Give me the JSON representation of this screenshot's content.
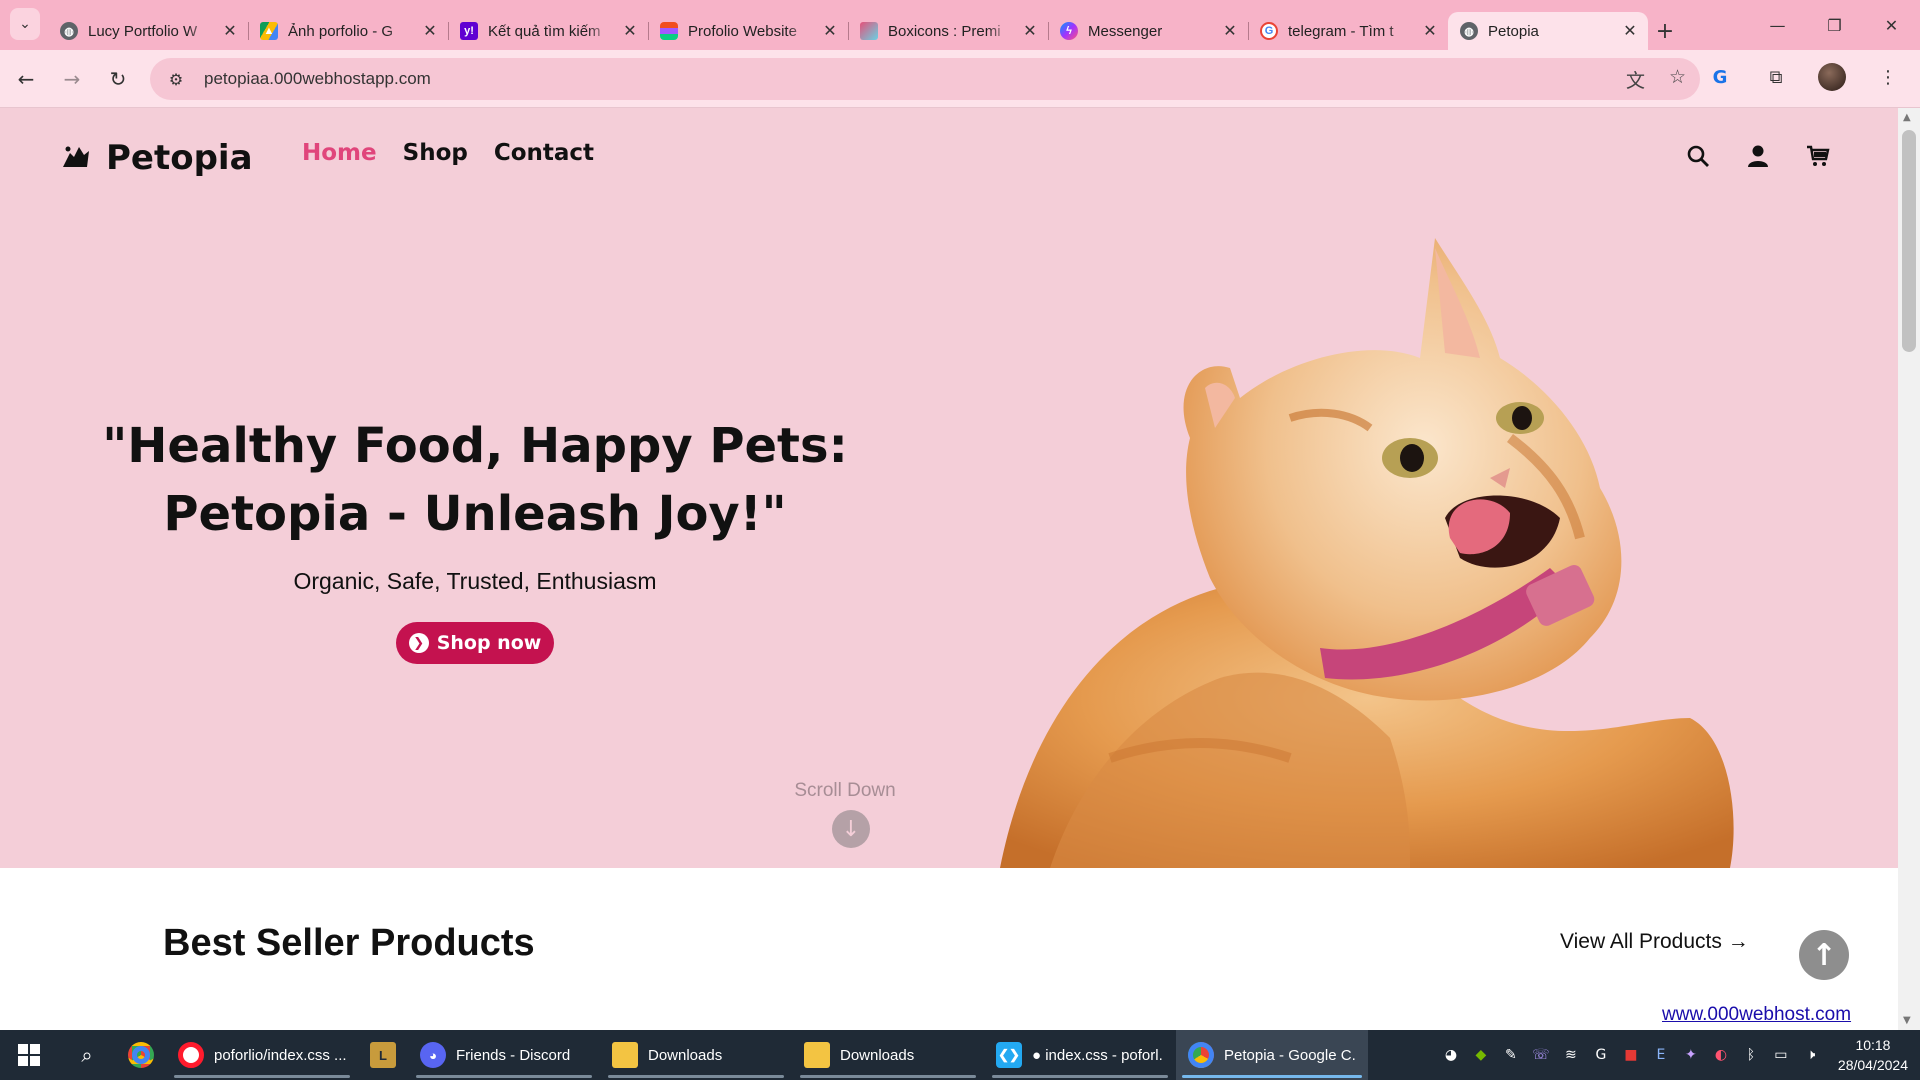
{
  "browser": {
    "tabs": [
      {
        "title": "Lucy Portfolio W",
        "icon": "globe-icon",
        "color": "#5f6368"
      },
      {
        "title": "Ảnh porfolio - G",
        "icon": "google-drive-icon",
        "color": "#1fa463"
      },
      {
        "title": "Kết quả tìm kiếm",
        "icon": "yahoo-icon",
        "color": "#6001d2"
      },
      {
        "title": "Profolio Website",
        "icon": "figma-icon",
        "color": "#f24e1e"
      },
      {
        "title": "Boxicons : Premi",
        "icon": "boxicons-icon",
        "color": "#e4527a"
      },
      {
        "title": "Messenger",
        "icon": "messenger-icon",
        "color": "#7c4dff"
      },
      {
        "title": "telegram - Tìm t",
        "icon": "google-icon",
        "color": "#4285f4"
      },
      {
        "title": "Petopia",
        "icon": "globe-icon",
        "color": "#5f6368",
        "active": true
      }
    ],
    "url": "petopiaa.000webhostapp.com"
  },
  "site": {
    "logo": "Petopia",
    "nav": [
      {
        "label": "Home",
        "active": true
      },
      {
        "label": "Shop"
      },
      {
        "label": "Contact"
      }
    ],
    "hero": {
      "headline_line1": "\"Healthy Food, Happy Pets:",
      "headline_line2": "Petopia - Unleash Joy!\"",
      "subline": "Organic, Safe, Trusted, Enthusiasm",
      "cta": "Shop now",
      "scroll_label": "Scroll Down"
    },
    "best_seller": {
      "title": "Best Seller Products",
      "view_all": "View All Products"
    },
    "host_link": "www.000webhost.com",
    "colors": {
      "accent": "#e0457b",
      "button": "#c4124f",
      "hero_bg": "#f4ced8"
    }
  },
  "taskbar": {
    "items": [
      {
        "label": "",
        "icon": "chrome-icon",
        "color": "#4285f4"
      },
      {
        "label": "poforlio/index.css ...",
        "icon": "opera-icon",
        "color": "#ff1b2d",
        "wide": true
      },
      {
        "label": "",
        "icon": "league-icon",
        "color": "#c89b3c"
      },
      {
        "label": "Friends - Discord",
        "icon": "discord-icon",
        "color": "#5865f2",
        "wide": true
      },
      {
        "label": "Downloads",
        "icon": "folder-icon",
        "color": "#f3c442",
        "wide": true
      },
      {
        "label": "Downloads",
        "icon": "folder-icon",
        "color": "#f3c442",
        "wide": true
      },
      {
        "label": "● index.css - poforl...",
        "icon": "vscode-icon",
        "color": "#23a9f2",
        "wide": true
      },
      {
        "label": "Petopia - Google C...",
        "icon": "chrome-icon",
        "color": "#4285f4",
        "wide": true,
        "selected": true
      }
    ],
    "time": "10:18",
    "date": "28/04/2024"
  }
}
